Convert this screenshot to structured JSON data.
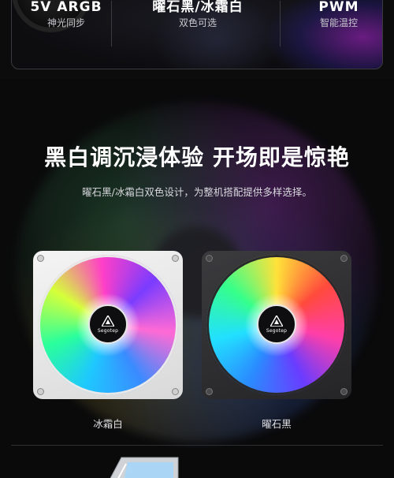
{
  "features": [
    {
      "title": "5V ARGB",
      "subtitle": "神光同步"
    },
    {
      "title": "曜石黑/冰霜白",
      "subtitle": "双色可选"
    },
    {
      "title": "PWM",
      "subtitle": "智能温控"
    }
  ],
  "headline": "黑白调沉浸体验  开场即是惊艳",
  "subline": "曜石黑/冰霜白双色设计，为整机搭配提供多样选择。",
  "fans": [
    {
      "brand": "Segotep",
      "label": "冰霜白",
      "frame_color": "#f0f0f0"
    },
    {
      "brand": "Segotep",
      "label": "曜石黑",
      "frame_color": "#333336"
    }
  ],
  "icons": [
    "segotep-logo-icon",
    "screw-icon"
  ]
}
